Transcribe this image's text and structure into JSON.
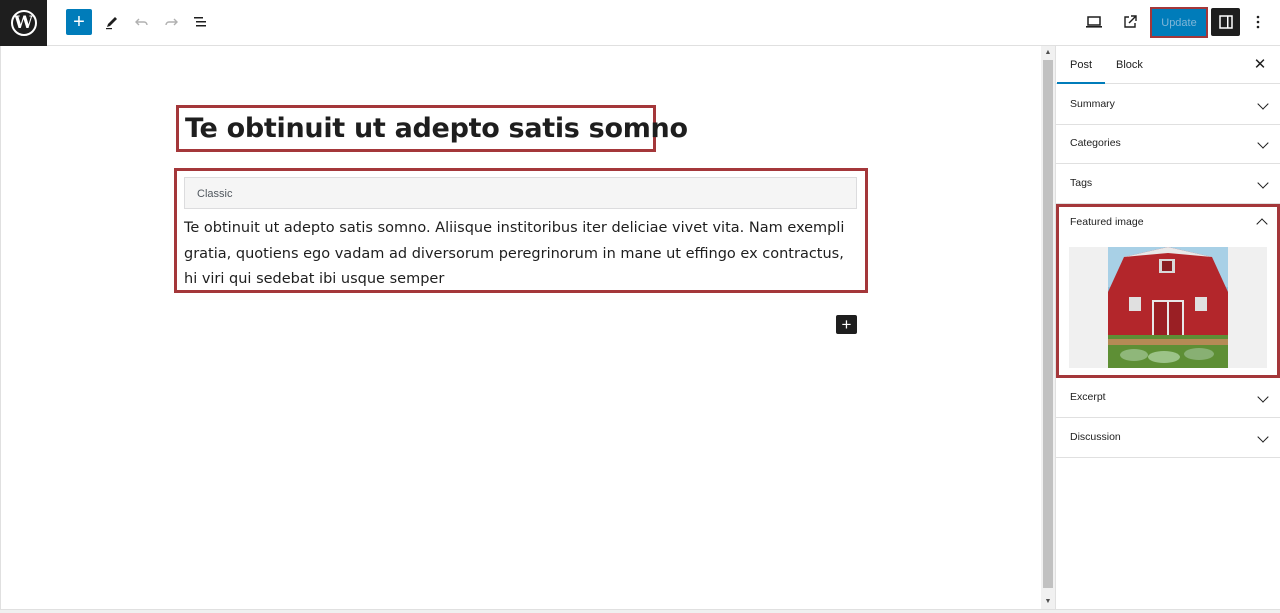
{
  "toolbar": {
    "logo_letter": "W",
    "add_symbol": "+",
    "update_label": "Update"
  },
  "post": {
    "title": "Te obtinuit ut adepto satis somno",
    "classic_label": "Classic",
    "content": "Te obtinuit ut adepto satis somno. Aliisque institoribus iter deliciae vivet vita. Nam exempli gratia, quotiens ego vadam ad diversorum peregrinorum in mane ut effingo ex contractus, hi viri qui sedebat ibi usque semper"
  },
  "block_adder_symbol": "+",
  "sidebar": {
    "tabs": [
      {
        "label": "Post",
        "active": true
      },
      {
        "label": "Block",
        "active": false
      }
    ],
    "close_symbol": "✕",
    "panels": {
      "summary": "Summary",
      "categories": "Categories",
      "tags": "Tags",
      "featured_image": "Featured image",
      "excerpt": "Excerpt",
      "discussion": "Discussion"
    }
  },
  "colors": {
    "accent": "#007cba",
    "highlight_border": "#a4373a",
    "dark": "#1e1e1e"
  }
}
